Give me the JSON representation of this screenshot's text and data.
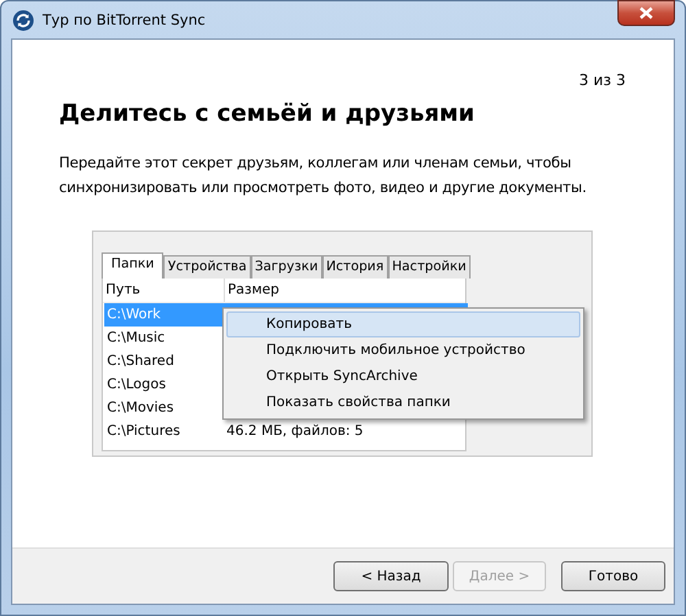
{
  "window": {
    "title": "Тур по BitTorrent Sync"
  },
  "step": "3 из 3",
  "heading": "Делитесь с семьёй и друзьями",
  "description": "Передайте этот секрет друзьям, коллегам или членам семьи, чтобы синхронизировать или просмотреть фото, видео и другие документы.",
  "tabs": [
    {
      "label": "Папки",
      "selected": true
    },
    {
      "label": "Устройства",
      "selected": false
    },
    {
      "label": "Загрузки",
      "selected": false
    },
    {
      "label": "История",
      "selected": false
    },
    {
      "label": "Настройки",
      "selected": false
    }
  ],
  "table": {
    "columns": [
      "Путь",
      "Размер"
    ],
    "rows": [
      {
        "path": "C:\\Work",
        "selected": true
      },
      {
        "path": "C:\\Music",
        "selected": false
      },
      {
        "path": "C:\\Shared",
        "selected": false
      },
      {
        "path": "C:\\Logos",
        "selected": false
      },
      {
        "path": "C:\\Movies",
        "selected": false
      },
      {
        "path": "C:\\Pictures",
        "size": "46.2 МБ, файлов: 5",
        "selected": false
      }
    ]
  },
  "context_menu": [
    {
      "label": "Копировать",
      "selected": true
    },
    {
      "label": "Подключить мобильное устройство",
      "selected": false
    },
    {
      "label": "Открыть SyncArchive",
      "selected": false
    },
    {
      "label": "Показать свойства папки",
      "selected": false
    }
  ],
  "buttons": [
    {
      "label": "< Назад",
      "disabled": false
    },
    {
      "label": "Далее >",
      "disabled": true
    },
    {
      "label": "Готово",
      "disabled": false
    }
  ]
}
